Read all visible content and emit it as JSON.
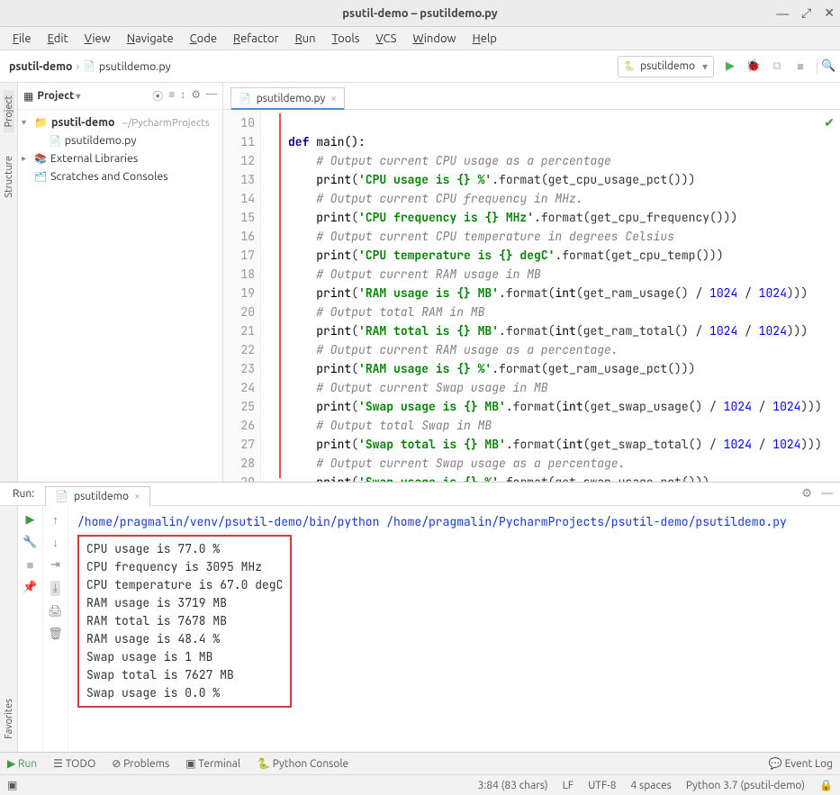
{
  "window": {
    "title": "psutil-demo – psutildemo.py"
  },
  "menubar": [
    "File",
    "Edit",
    "View",
    "Navigate",
    "Code",
    "Refactor",
    "Run",
    "Tools",
    "VCS",
    "Window",
    "Help"
  ],
  "breadcrumb": {
    "root": "psutil-demo",
    "file": "psutildemo.py"
  },
  "interpreter": "psutildemo",
  "toolbar_icons": {
    "run": "run",
    "debug": "debug",
    "cov": "coverage",
    "stop": "stop",
    "search": "search"
  },
  "project": {
    "title": "Project",
    "tree": {
      "root": {
        "name": "psutil-demo",
        "hint": "~/PycharmProjects"
      },
      "file": "psutildemo.py",
      "ext_libs": "External Libraries",
      "scratches": "Scratches and Consoles"
    }
  },
  "side_tabs": {
    "project": "Project",
    "structure": "Structure",
    "favorites": "Favorites"
  },
  "editor": {
    "tab_name": "psutildemo.py",
    "first_line_no": 10,
    "lines": [
      {
        "type": "code",
        "tokens": []
      },
      {
        "type": "code",
        "tokens": [
          {
            "k": "def ",
            "cls": "k"
          },
          {
            "k": "main():",
            "cls": "fn"
          }
        ]
      },
      {
        "type": "code",
        "tokens": [
          {
            "k": "    "
          },
          {
            "k": "# Output current CPU usage as a percentage",
            "cls": "c"
          }
        ]
      },
      {
        "type": "code",
        "tokens": [
          {
            "k": "    "
          },
          {
            "k": "print",
            "cls": "fn"
          },
          {
            "k": "("
          },
          {
            "k": "'CPU usage is {} %'",
            "cls": "s"
          },
          {
            "k": ".format(get_cpu_usage_pct()))"
          }
        ]
      },
      {
        "type": "code",
        "tokens": [
          {
            "k": "    "
          },
          {
            "k": "# Output current CPU frequency in MHz.",
            "cls": "c"
          }
        ]
      },
      {
        "type": "code",
        "tokens": [
          {
            "k": "    "
          },
          {
            "k": "print",
            "cls": "fn"
          },
          {
            "k": "("
          },
          {
            "k": "'CPU frequency is {} MHz'",
            "cls": "s"
          },
          {
            "k": ".format(get_cpu_frequency()))"
          }
        ]
      },
      {
        "type": "code",
        "tokens": [
          {
            "k": "    "
          },
          {
            "k": "# Output current CPU temperature in degrees Celsius",
            "cls": "c"
          }
        ]
      },
      {
        "type": "code",
        "tokens": [
          {
            "k": "    "
          },
          {
            "k": "print",
            "cls": "fn"
          },
          {
            "k": "("
          },
          {
            "k": "'CPU temperature is {} degC'",
            "cls": "s"
          },
          {
            "k": ".format(get_cpu_temp()))"
          }
        ]
      },
      {
        "type": "code",
        "tokens": [
          {
            "k": "    "
          },
          {
            "k": "# Output current RAM usage in MB",
            "cls": "c"
          }
        ]
      },
      {
        "type": "code",
        "tokens": [
          {
            "k": "    "
          },
          {
            "k": "print",
            "cls": "fn"
          },
          {
            "k": "("
          },
          {
            "k": "'RAM usage is {} MB'",
            "cls": "s"
          },
          {
            "k": ".format("
          },
          {
            "k": "int",
            "cls": "fn"
          },
          {
            "k": "(get_ram_usage() / "
          },
          {
            "k": "1024",
            "cls": "n"
          },
          {
            "k": " / "
          },
          {
            "k": "1024",
            "cls": "n"
          },
          {
            "k": ")))"
          }
        ]
      },
      {
        "type": "code",
        "tokens": [
          {
            "k": "    "
          },
          {
            "k": "# Output total RAM in MB",
            "cls": "c"
          }
        ]
      },
      {
        "type": "code",
        "tokens": [
          {
            "k": "    "
          },
          {
            "k": "print",
            "cls": "fn"
          },
          {
            "k": "("
          },
          {
            "k": "'RAM total is {} MB'",
            "cls": "s"
          },
          {
            "k": ".format("
          },
          {
            "k": "int",
            "cls": "fn"
          },
          {
            "k": "(get_ram_total() / "
          },
          {
            "k": "1024",
            "cls": "n"
          },
          {
            "k": " / "
          },
          {
            "k": "1024",
            "cls": "n"
          },
          {
            "k": ")))"
          }
        ]
      },
      {
        "type": "code",
        "tokens": [
          {
            "k": "    "
          },
          {
            "k": "# Output current RAM usage as a percentage.",
            "cls": "c"
          }
        ]
      },
      {
        "type": "code",
        "tokens": [
          {
            "k": "    "
          },
          {
            "k": "print",
            "cls": "fn"
          },
          {
            "k": "("
          },
          {
            "k": "'RAM usage is {} %'",
            "cls": "s"
          },
          {
            "k": ".format(get_ram_usage_pct()))"
          }
        ]
      },
      {
        "type": "code",
        "tokens": [
          {
            "k": "    "
          },
          {
            "k": "# Output current Swap usage in MB",
            "cls": "c"
          }
        ]
      },
      {
        "type": "code",
        "tokens": [
          {
            "k": "    "
          },
          {
            "k": "print",
            "cls": "fn"
          },
          {
            "k": "("
          },
          {
            "k": "'Swap usage is {} MB'",
            "cls": "s"
          },
          {
            "k": ".format("
          },
          {
            "k": "int",
            "cls": "fn"
          },
          {
            "k": "(get_swap_usage() / "
          },
          {
            "k": "1024",
            "cls": "n"
          },
          {
            "k": " / "
          },
          {
            "k": "1024",
            "cls": "n"
          },
          {
            "k": ")))"
          }
        ]
      },
      {
        "type": "code",
        "tokens": [
          {
            "k": "    "
          },
          {
            "k": "# Output total Swap in MB",
            "cls": "c"
          }
        ]
      },
      {
        "type": "code",
        "tokens": [
          {
            "k": "    "
          },
          {
            "k": "print",
            "cls": "fn"
          },
          {
            "k": "("
          },
          {
            "k": "'Swap total is {} MB'",
            "cls": "s"
          },
          {
            "k": ".format("
          },
          {
            "k": "int",
            "cls": "fn"
          },
          {
            "k": "(get_swap_total() / "
          },
          {
            "k": "1024",
            "cls": "n"
          },
          {
            "k": " / "
          },
          {
            "k": "1024",
            "cls": "n"
          },
          {
            "k": ")))"
          }
        ]
      },
      {
        "type": "code",
        "tokens": [
          {
            "k": "    "
          },
          {
            "k": "# Output current Swap usage as a percentage.",
            "cls": "c"
          }
        ]
      },
      {
        "type": "code",
        "tokens": [
          {
            "k": "    "
          },
          {
            "k": "print",
            "cls": "fn"
          },
          {
            "k": "("
          },
          {
            "k": "'Swap usage is {} %'",
            "cls": "s"
          },
          {
            "k": ".format(get_swap_usage_pct()))"
          }
        ]
      },
      {
        "type": "code",
        "tokens": []
      },
      {
        "type": "code",
        "tokens": []
      }
    ]
  },
  "run": {
    "label": "Run:",
    "tab": "psutildemo",
    "cmd": "/home/pragmalin/venv/psutil-demo/bin/python /home/pragmalin/PycharmProjects/psutil-demo/psutildemo.py",
    "output": [
      "CPU usage is 77.0 %",
      "CPU frequency is 3095 MHz",
      "CPU temperature is 67.0 degC",
      "RAM usage is 3719 MB",
      "RAM total is 7678 MB",
      "RAM usage is 48.4 %",
      "Swap usage is 1 MB",
      "Swap total is 7627 MB",
      "Swap usage is 0.0 %"
    ]
  },
  "bottom_toolbar": {
    "run": "Run",
    "todo": "TODO",
    "problems": "Problems",
    "terminal": "Terminal",
    "python_console": "Python Console",
    "event_log": "Event Log"
  },
  "statusline": {
    "pos": "3:84 (83 chars)",
    "lf": "LF",
    "enc": "UTF-8",
    "indent": "4 spaces",
    "interp": "Python 3.7 (psutil-demo)"
  }
}
